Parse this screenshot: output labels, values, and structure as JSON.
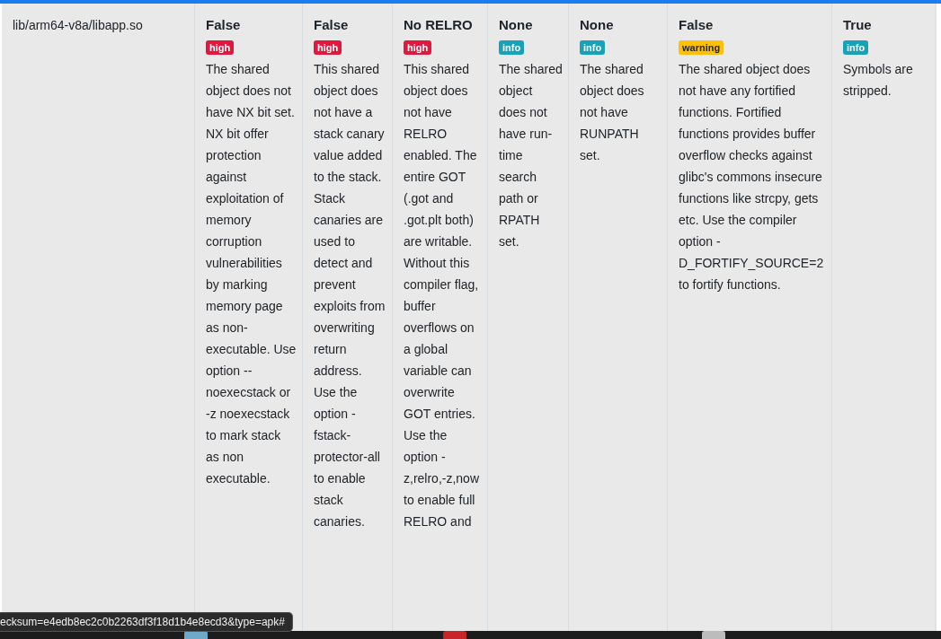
{
  "row": {
    "file": "lib/arm64-v8a/libapp.so",
    "checks": [
      {
        "value": "False",
        "severity": "high",
        "description": "The shared object does not have NX bit set. NX bit offer protection against exploitation of memory corruption vulnerabilities by marking memory page as non-executable. Use option --noexecstack or -z noexecstack to mark stack as non executable."
      },
      {
        "value": "False",
        "severity": "high",
        "description": "This shared object does not have a stack canary value added to the stack. Stack canaries are used to detect and prevent exploits from overwriting return address. Use the option -fstack-protector-all to enable stack canaries."
      },
      {
        "value": "No RELRO",
        "severity": "high",
        "description": "This shared object does not have RELRO enabled. The entire GOT (.got and .got.plt both) are writable. Without this compiler flag, buffer overflows on a global variable can overwrite GOT entries. Use the option -z,relro,-z,now to enable full RELRO and"
      },
      {
        "value": "None",
        "severity": "info",
        "description": "The shared object does not have run-time search path or RPATH set."
      },
      {
        "value": "None",
        "severity": "info",
        "description": "The shared object does not have RUNPATH set."
      },
      {
        "value": "False",
        "severity": "warning",
        "description": "The shared object does not have any fortified functions. Fortified functions provides buffer overflow checks against glibc's commons insecure functions like strcpy, gets etc. Use the compiler option -D_FORTIFY_SOURCE=2 to fortify functions."
      },
      {
        "value": "True",
        "severity": "info",
        "description": "Symbols are stripped."
      }
    ]
  },
  "status_url": "ecksum=e4edb8ec2c0b2263df3f18d1b4e8ecd3&type=apk#"
}
